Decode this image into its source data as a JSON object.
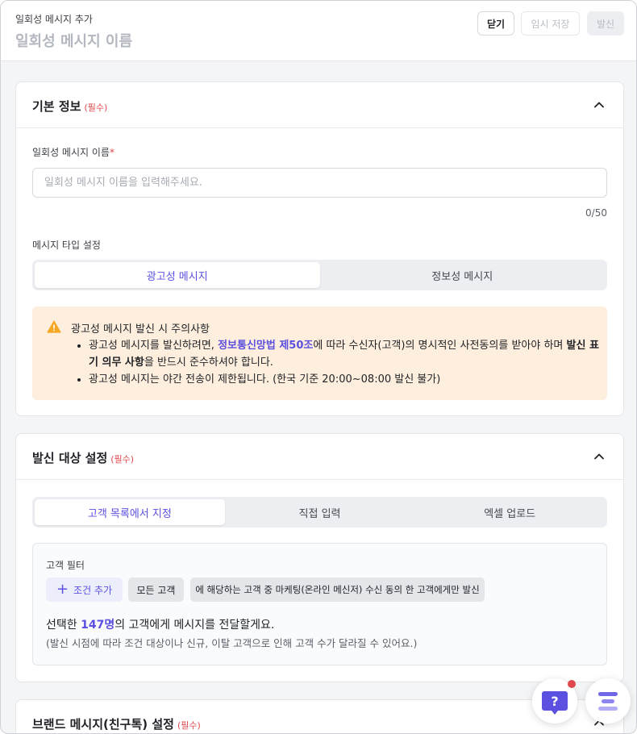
{
  "header": {
    "breadcrumb": "일회성 메시지 추가",
    "title": "일회성 메시지 이름",
    "close_label": "닫기",
    "draft_label": "임시 저장",
    "send_label": "발신"
  },
  "basic_info": {
    "title": "기본 정보",
    "required": "(필수)",
    "name_label": "일회성 메시지 이름",
    "name_required_mark": "*",
    "name_placeholder": "일회성 메시지 이름을 입력해주세요.",
    "name_value": "",
    "counter": "0/50",
    "type_label": "메시지 타입 설정",
    "type_options": [
      "광고성 메시지",
      "정보성 메시지"
    ],
    "type_selected": "광고성 메시지",
    "warning": {
      "title": "광고성 메시지 발신 시 주의사항",
      "line1_pre": "광고성 메시지를 발신하려면, ",
      "line1_link": "정보통신망법 제50조",
      "line1_mid": "에 따라 수신자(고객)의 명시적인 사전동의를 받아야 하며 ",
      "line1_bold": "발신 표기 의무 사항",
      "line1_post": "을 반드시 준수하셔야 합니다.",
      "line2": "광고성 메시지는 야간 전송이 제한됩니다. (한국 기준 20:00~08:00 발신 불가)"
    }
  },
  "target": {
    "title": "발신 대상 설정",
    "required": "(필수)",
    "tabs": [
      "고객 목록에서 지정",
      "직접 입력",
      "엑셀 업로드"
    ],
    "tab_selected": "고객 목록에서 지정",
    "filter_title": "고객 필터",
    "add_condition": "조건 추가",
    "chip_all": "모든 고객",
    "chip_condition": "에 해당하는 고객 중 마케팅(온라인 메신저) 수신 동의 한 고객에게만 발신",
    "selected_pre": "선택한 ",
    "selected_count": "147명",
    "selected_post": "의 고객에게 메시지를 전달할게요.",
    "note": "(발신 시점에 따라 조건 대상이나 신규, 이탈 고객으로 인해 고객 수가 달라질 수 있어요.)"
  },
  "brand": {
    "title": "브랜드 메시지(친구톡) 설정",
    "required": "(필수)"
  },
  "colors": {
    "accent": "#5b50e0",
    "required": "#e0484d",
    "warning_bg": "#fdeedd",
    "warning_icon": "#f5a623"
  },
  "icons": {
    "chevron": "chevron-up-icon",
    "warning": "warning-triangle-icon",
    "help": "help-chat-icon",
    "menu": "menu-lines-icon"
  }
}
